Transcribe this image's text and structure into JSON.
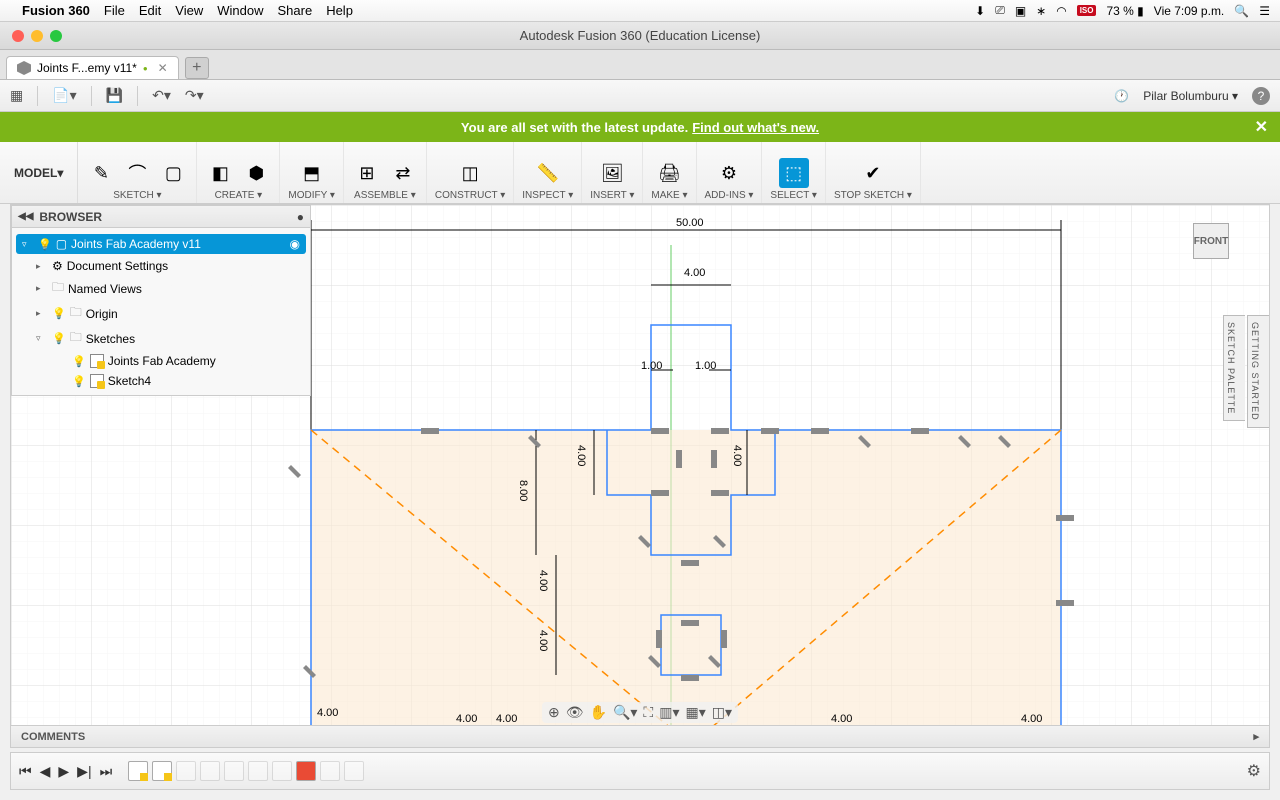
{
  "os": {
    "app": "Fusion 360",
    "menu": [
      "File",
      "Edit",
      "View",
      "Window",
      "Share",
      "Help"
    ],
    "battery": "73 %",
    "time": "Vie 7:09 p.m.",
    "flag": "ISO"
  },
  "window": {
    "title": "Autodesk Fusion 360 (Education License)"
  },
  "tab": {
    "name": "Joints F...emy v11*"
  },
  "topbar": {
    "user": "Pilar Bolumburu"
  },
  "banner": {
    "text": "You are all set with the latest update.",
    "link": "Find out what's new."
  },
  "workspace_mode": "MODEL",
  "ribbon": [
    {
      "label": "SKETCH",
      "icons": [
        "✎",
        "⌒",
        "▢"
      ]
    },
    {
      "label": "CREATE",
      "icons": [
        "◧",
        "⬢"
      ]
    },
    {
      "label": "MODIFY",
      "icons": [
        "⬒"
      ]
    },
    {
      "label": "ASSEMBLE",
      "icons": [
        "⊞",
        "⇄"
      ]
    },
    {
      "label": "CONSTRUCT",
      "icons": [
        "◫"
      ]
    },
    {
      "label": "INSPECT",
      "icons": [
        "📏"
      ]
    },
    {
      "label": "INSERT",
      "icons": [
        "🖼"
      ]
    },
    {
      "label": "MAKE",
      "icons": [
        "🖨"
      ]
    },
    {
      "label": "ADD-INS",
      "icons": [
        "⚙"
      ]
    },
    {
      "label": "SELECT",
      "icons": [
        "⬚"
      ],
      "selected": true
    },
    {
      "label": "STOP SKETCH",
      "icons": [
        "✔"
      ]
    }
  ],
  "browser": {
    "title": "BROWSER",
    "root": "Joints Fab Academy v11",
    "items": [
      {
        "label": "Document Settings",
        "icon": "gear"
      },
      {
        "label": "Named Views",
        "icon": "folder"
      },
      {
        "label": "Origin",
        "icon": "folder",
        "bulb": true
      },
      {
        "label": "Sketches",
        "icon": "folder",
        "bulb": true,
        "expanded": true,
        "children": [
          {
            "label": "Joints Fab Academy"
          },
          {
            "label": "Sketch4"
          }
        ]
      }
    ]
  },
  "viewcube": "FRONT",
  "palettes": [
    "GETTING STARTED",
    "SKETCH PALETTE"
  ],
  "comments": "COMMENTS",
  "dimensions": {
    "overall_width": "50.00",
    "slot_width": "4.00",
    "clearance_left": "1.00",
    "clearance_right": "1.00",
    "depth1": "8.00",
    "depth2": "4.00",
    "depth3": "4.00",
    "inner_left": "4.00",
    "inner_right": "4.00",
    "bottom_dims": [
      "4.00",
      "4.00",
      "4.00",
      "4.00",
      "4.00"
    ]
  }
}
